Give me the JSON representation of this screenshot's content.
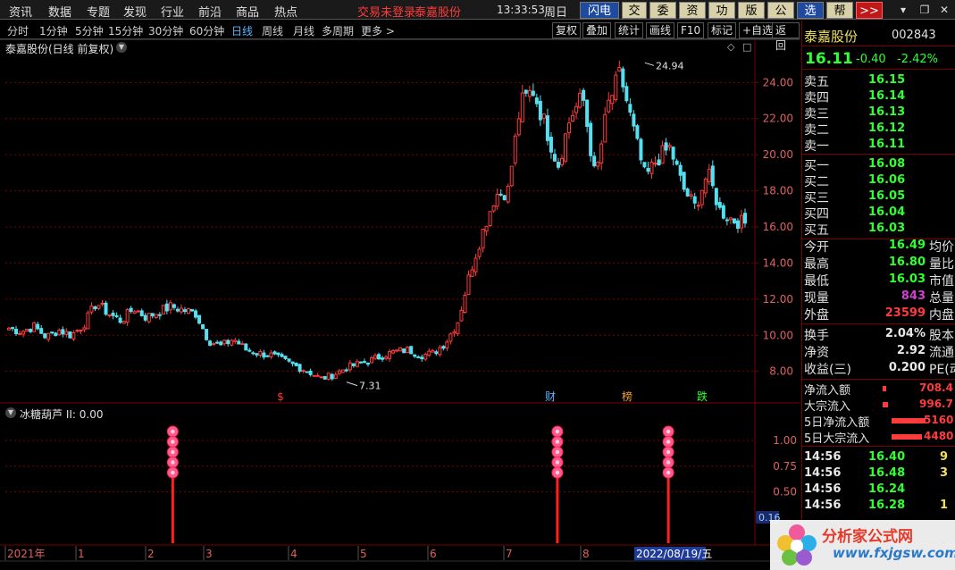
{
  "menu": {
    "items": [
      "资讯",
      "数据",
      "专题",
      "发现",
      "行业",
      "前沿",
      "商品",
      "热点"
    ],
    "trade_status": "交易未登录",
    "current_stock": "泰嘉股份",
    "time": "13:33:53",
    "weekday": "周日",
    "toolbar": [
      {
        "label": "闪电手",
        "style": "blue"
      },
      {
        "label": "交易",
        "style": ""
      },
      {
        "label": "委托",
        "style": ""
      },
      {
        "label": "资讯",
        "style": ""
      },
      {
        "label": "功能",
        "style": ""
      },
      {
        "label": "版面",
        "style": ""
      },
      {
        "label": "公式",
        "style": ""
      },
      {
        "label": "选项",
        "style": "blue"
      },
      {
        "label": "帮助",
        "style": ""
      },
      {
        "label": ">>",
        "style": "red"
      }
    ]
  },
  "periods": {
    "items": [
      "分时",
      "1分钟",
      "5分钟",
      "15分钟",
      "30分钟",
      "60分钟",
      "日线",
      "周线",
      "月线",
      "多周期",
      "更多 >"
    ],
    "active": "日线",
    "tools": [
      "复权",
      "叠加",
      "统计",
      "画线",
      "F10",
      "标记",
      "+自选",
      "返回"
    ]
  },
  "chart": {
    "title": "泰嘉股份(日线 前复权)",
    "high_label": "24.94",
    "low_label": "7.31",
    "events": [
      {
        "text": "$",
        "color": "#ff3b3b"
      },
      {
        "text": "财",
        "color": "#5ab4ff"
      },
      {
        "text": "榜",
        "color": "#f0a030"
      },
      {
        "text": "跌",
        "color": "#30ff30"
      }
    ],
    "indicator_title": "冰糖葫芦 II: 0.00",
    "ind_ticks": [
      "1.00",
      "0.75",
      "0.50"
    ],
    "ind_partial": "0.16",
    "x_labels": [
      "2021年",
      "1",
      "2",
      "3",
      "4",
      "5",
      "6",
      "7",
      "8"
    ],
    "cursor_date": "2022/08/19/五"
  },
  "chart_data": {
    "type": "candlestick",
    "title": "泰嘉股份(日线 前复权)",
    "y_ticks": [
      8.0,
      10.0,
      12.0,
      14.0,
      16.0,
      18.0,
      20.0,
      22.0,
      24.0
    ],
    "ylim": [
      6.5,
      25.5
    ],
    "period_max": 24.94,
    "period_min": 7.31,
    "close_path": [
      10.4,
      10.2,
      10.5,
      9.9,
      10.3,
      10.0,
      10.6,
      11.8,
      11.2,
      10.8,
      11.5,
      11.0,
      11.3,
      11.6,
      11.4,
      11.2,
      9.7,
      9.4,
      9.8,
      9.2,
      9.0,
      8.9,
      8.6,
      8.3,
      8.0,
      7.6,
      7.8,
      8.2,
      8.4,
      8.6,
      8.9,
      9.1,
      9.2,
      8.9,
      9.0,
      9.6,
      10.8,
      13.6,
      15.8,
      17.8,
      18.0,
      22.8,
      23.6,
      21.6,
      19.4,
      22.1,
      23.2,
      18.6,
      22.7,
      24.5,
      21.5,
      18.7,
      19.8,
      20.4,
      18.2,
      17.1,
      19.0,
      16.9,
      16.4,
      16.2
    ],
    "indicator_signals": [
      {
        "date_index_fraction": 0.12,
        "value": 1.0
      },
      {
        "date_index_fraction": 0.64,
        "value": 1.0
      },
      {
        "date_index_fraction": 0.79,
        "value": 1.0
      }
    ],
    "indicator_ylim": [
      0,
      1.2
    ]
  },
  "quote": {
    "name": "泰嘉股份",
    "code": "002843",
    "price": "16.11",
    "change": "-0.40",
    "change_pct": "-2.42%",
    "asks": [
      {
        "label": "卖五",
        "price": "16.15"
      },
      {
        "label": "卖四",
        "price": "16.14"
      },
      {
        "label": "卖三",
        "price": "16.13"
      },
      {
        "label": "卖二",
        "price": "16.12"
      },
      {
        "label": "卖一",
        "price": "16.11"
      }
    ],
    "bids": [
      {
        "label": "买一",
        "price": "16.08"
      },
      {
        "label": "买二",
        "price": "16.06"
      },
      {
        "label": "买三",
        "price": "16.05"
      },
      {
        "label": "买四",
        "price": "16.04"
      },
      {
        "label": "买五",
        "price": "16.03"
      }
    ],
    "stats": [
      {
        "label": "今开",
        "value": "16.49",
        "color": "green",
        "right": "均价"
      },
      {
        "label": "最高",
        "value": "16.80",
        "color": "green",
        "right": "量比"
      },
      {
        "label": "最低",
        "value": "16.03",
        "color": "green",
        "right": "市值"
      },
      {
        "label": "现量",
        "value": "843",
        "color": "purple",
        "right": "总量"
      },
      {
        "label": "外盘",
        "value": "23599",
        "color": "red",
        "right": "内盘"
      }
    ],
    "stats2": [
      {
        "label": "换手",
        "value": "2.04%",
        "color": "white",
        "right": "股本"
      },
      {
        "label": "净资",
        "value": "2.92",
        "color": "white",
        "right": "流通"
      },
      {
        "label": "收益(三)",
        "value": "0.200",
        "color": "white",
        "right": "PE(动)"
      }
    ],
    "flows": [
      {
        "label": "净流入额",
        "value": "708.4",
        "bar": 4
      },
      {
        "label": "大宗流入",
        "value": "996.7",
        "bar": 6
      },
      {
        "label": "5日净流入额",
        "value": "5160",
        "bar": 38
      },
      {
        "label": "5日大宗流入",
        "value": "4480",
        "bar": 34
      }
    ],
    "ticks": [
      {
        "time": "14:56",
        "price": "16.40",
        "vol": "9"
      },
      {
        "time": "14:56",
        "price": "16.48",
        "vol": "3"
      },
      {
        "time": "14:56",
        "price": "16.24",
        "vol": ""
      },
      {
        "time": "14:56",
        "price": "16.28",
        "vol": "1"
      }
    ]
  },
  "watermark": {
    "name": "分析家公式网",
    "url": "www.fxjgsw.com"
  },
  "colors": {
    "up": "#ff3b3b",
    "down": "#54e0f0",
    "grid": "#7a0000",
    "bg": "#000000"
  }
}
